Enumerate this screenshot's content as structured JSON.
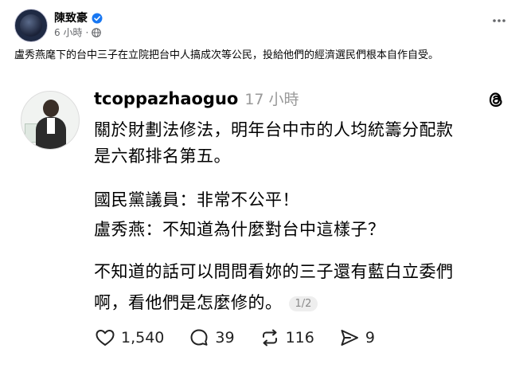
{
  "post": {
    "author": "陳致豪",
    "meta_time": "6 小時",
    "text": "盧秀燕麾下的台中三子在立院把台中人搞成次等公民，投給他們的經濟選民們根本自作自受。"
  },
  "thread": {
    "username": "tcoppazhaoguo",
    "time": "17 小時",
    "para1_line1": "關於財劃法修法，明年台中市的人均統籌分配款",
    "para1_line2": "是六都排名第五。",
    "para2_line1": "國民黨議員：非常不公平！",
    "para2_line2": "盧秀燕：不知道為什麼對台中這樣子？",
    "para3_line1": "不知道的話可以問問看妳的三子還有藍白立委們",
    "para3_line2": "啊，看他們是怎麼修的。",
    "page_indicator": "1/2"
  },
  "actions": {
    "likes": "1,540",
    "replies": "39",
    "reposts": "116",
    "shares": "9"
  },
  "colors": {
    "verified": "#1877f2",
    "muted": "#65676b",
    "threads_muted": "#999999"
  },
  "icons": [
    "verified-icon",
    "globe-icon",
    "more-icon",
    "threads-logo-icon",
    "heart-icon",
    "comment-icon",
    "repost-icon",
    "share-icon"
  ]
}
